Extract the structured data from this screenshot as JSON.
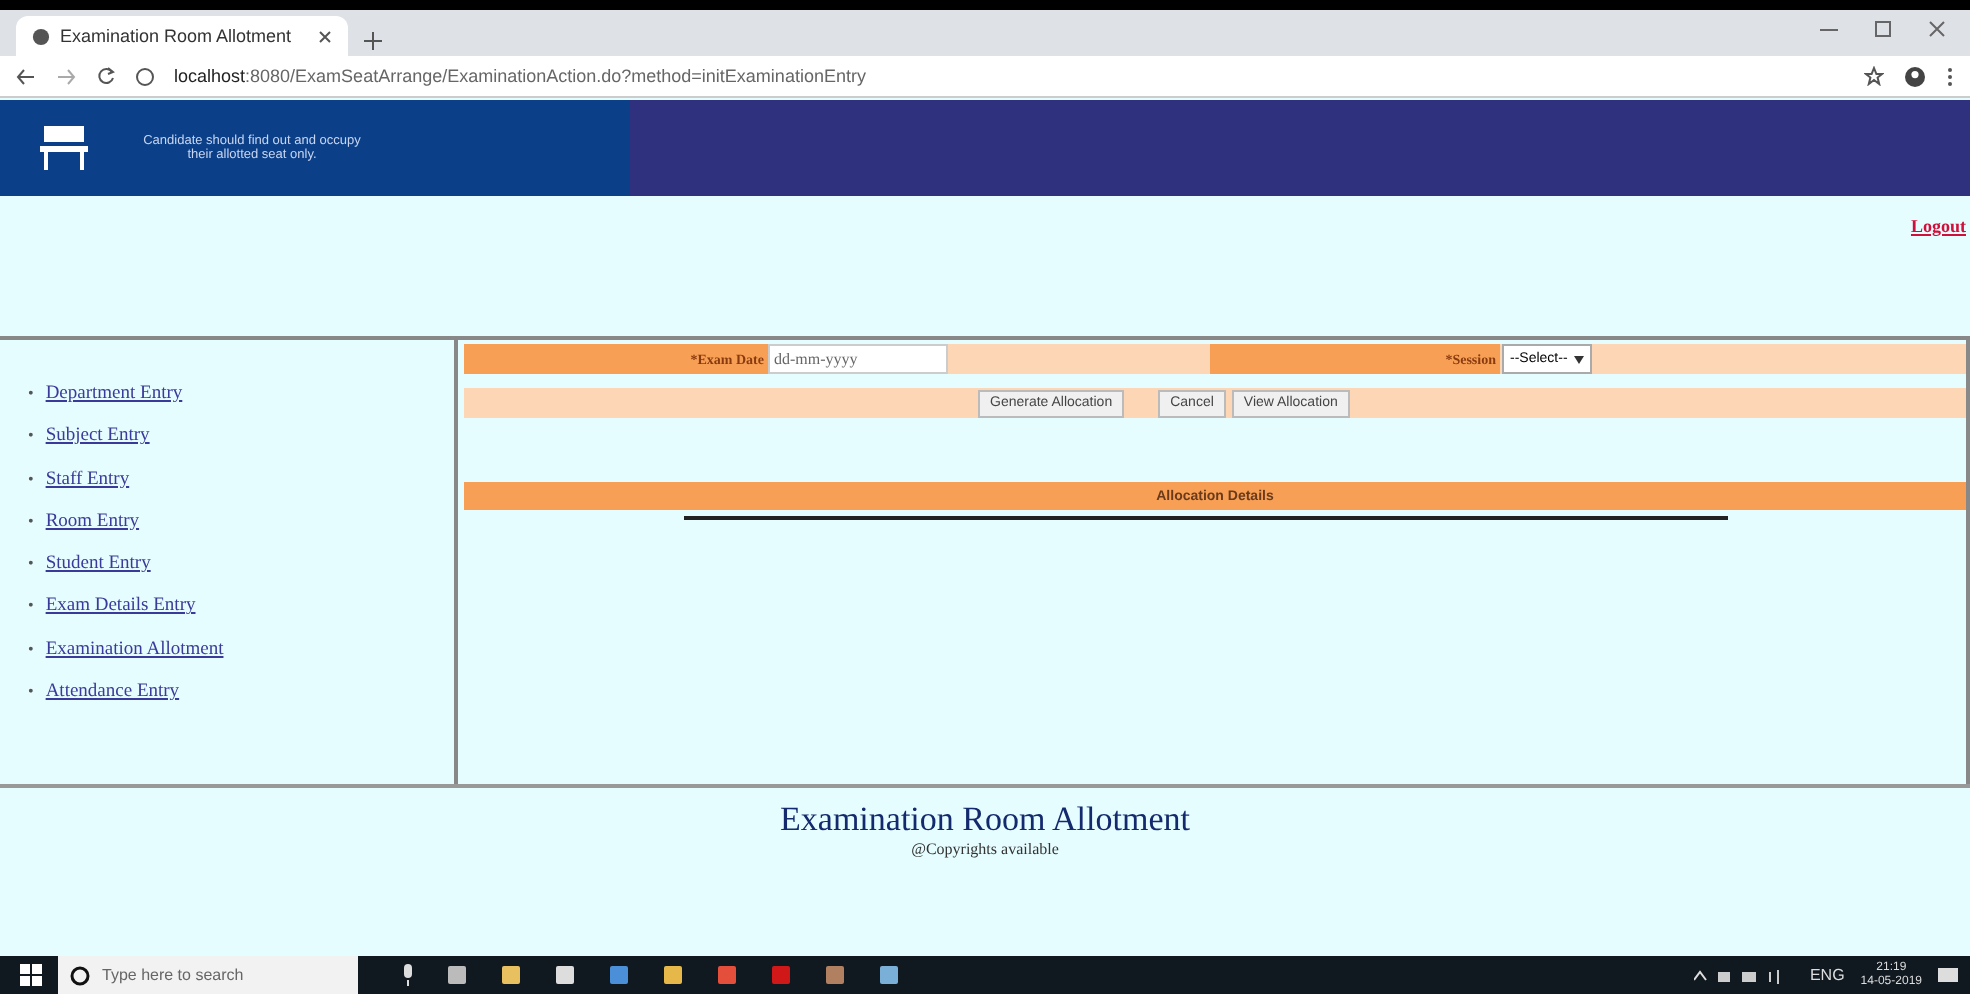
{
  "browser": {
    "tab_title": "Examination Room Allotment",
    "url_host": "localhost",
    "url_rest": ":8080/ExamSeatArrange/ExaminationAction.do?method=initExaminationEntry"
  },
  "header": {
    "message": "Candidate should find out and occupy their allotted seat only."
  },
  "logout": "Logout",
  "nav_bullet": "•",
  "nav": [
    "Department Entry",
    "Subject Entry",
    "Staff Entry",
    "Room Entry",
    "Student Entry",
    "Exam Details Entry",
    "Examination Allotment",
    "Attendance Entry"
  ],
  "form": {
    "exam_date_label": "*Exam Date",
    "exam_date_placeholder": "dd-mm-yyyy",
    "session_label": "*Session",
    "session_value": "--Select--"
  },
  "buttons": [
    "Generate Allocation",
    "Cancel",
    "View Allocation"
  ],
  "section_title": "Allocation Details",
  "footer": {
    "title": "Examination Room Allotment",
    "copyright": "@Copyrights available"
  },
  "taskbar": {
    "search_placeholder": "Type here to search",
    "language": "ENG",
    "time": "21:19",
    "date": "14-05-2019"
  }
}
